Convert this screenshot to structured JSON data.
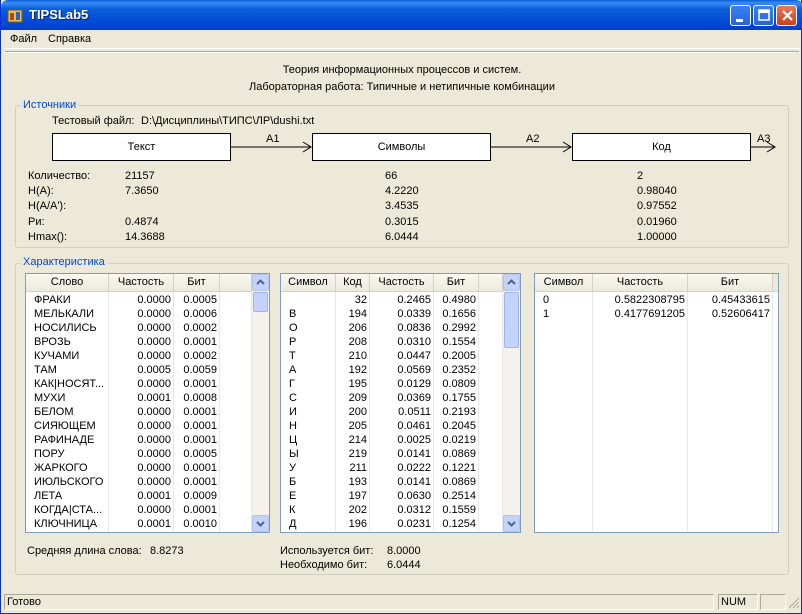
{
  "window": {
    "title": "TIPSLab5"
  },
  "menu": [
    "Файл",
    "Справка"
  ],
  "header": {
    "line1": "Теория информационных процессов и систем.",
    "line2": "Лабораторная работа: Типичные и нетипичные комбинации"
  },
  "sources": {
    "group_title": "Источники",
    "file_label": "Тестовый файл:",
    "file_path": "D:\\Дисциплины\\ТИПС\\ЛР\\dushi.txt",
    "boxes": [
      "Текст",
      "Символы",
      "Код"
    ],
    "arrows": [
      "A1",
      "A2",
      "A3"
    ],
    "row_labels": [
      "Количество:",
      "H(A):",
      "H(A/A'):",
      "Pи:",
      "Hmax():"
    ],
    "text_values": [
      "21157",
      "7.3650",
      "",
      "0.4874",
      "14.3688"
    ],
    "symbol_values": [
      "66",
      "4.2220",
      "3.4535",
      "0.3015",
      "6.0444"
    ],
    "code_values": [
      "2",
      "0.98040",
      "0.97552",
      "0.01960",
      "1.00000"
    ]
  },
  "characteristics": {
    "group_title": "Характеристика",
    "words": {
      "headers": [
        "Слово",
        "Частость",
        "Бит"
      ],
      "rows": [
        [
          "ФРАКИ",
          "0.0000",
          "0.0005"
        ],
        [
          "МЕЛЬКАЛИ",
          "0.0000",
          "0.0006"
        ],
        [
          "НОСИЛИСЬ",
          "0.0000",
          "0.0002"
        ],
        [
          "ВРОЗЬ",
          "0.0000",
          "0.0001"
        ],
        [
          "КУЧАМИ",
          "0.0000",
          "0.0002"
        ],
        [
          "ТАМ",
          "0.0005",
          "0.0059"
        ],
        [
          "КАК|НОСЯТ...",
          "0.0000",
          "0.0001"
        ],
        [
          "МУХИ",
          "0.0001",
          "0.0008"
        ],
        [
          "БЕЛОМ",
          "0.0000",
          "0.0001"
        ],
        [
          "СИЯЮЩЕМ",
          "0.0000",
          "0.0001"
        ],
        [
          "РАФИНАДЕ",
          "0.0000",
          "0.0001"
        ],
        [
          "ПОРУ",
          "0.0000",
          "0.0005"
        ],
        [
          "ЖАРКОГО",
          "0.0000",
          "0.0001"
        ],
        [
          "ИЮЛЬСКОГО",
          "0.0000",
          "0.0001"
        ],
        [
          "ЛЕТА",
          "0.0001",
          "0.0009"
        ],
        [
          "КОГДА|СТА...",
          "0.0000",
          "0.0001"
        ],
        [
          "КЛЮЧНИЦА",
          "0.0001",
          "0.0010"
        ]
      ]
    },
    "symbols": {
      "headers": [
        "Символ",
        "Код",
        "Частость",
        "Бит"
      ],
      "rows": [
        [
          "",
          "32",
          "0.2465",
          "0.4980"
        ],
        [
          "В",
          "194",
          "0.0339",
          "0.1656"
        ],
        [
          "О",
          "206",
          "0.0836",
          "0.2992"
        ],
        [
          "Р",
          "208",
          "0.0310",
          "0.1554"
        ],
        [
          "Т",
          "210",
          "0.0447",
          "0.2005"
        ],
        [
          "А",
          "192",
          "0.0569",
          "0.2352"
        ],
        [
          "Г",
          "195",
          "0.0129",
          "0.0809"
        ],
        [
          "С",
          "209",
          "0.0369",
          "0.1755"
        ],
        [
          "И",
          "200",
          "0.0511",
          "0.2193"
        ],
        [
          "Н",
          "205",
          "0.0461",
          "0.2045"
        ],
        [
          "Ц",
          "214",
          "0.0025",
          "0.0219"
        ],
        [
          "Ы",
          "219",
          "0.0141",
          "0.0869"
        ],
        [
          "У",
          "211",
          "0.0222",
          "0.1221"
        ],
        [
          "Б",
          "193",
          "0.0141",
          "0.0869"
        ],
        [
          "Е",
          "197",
          "0.0630",
          "0.2514"
        ],
        [
          "К",
          "202",
          "0.0312",
          "0.1559"
        ],
        [
          "Д",
          "196",
          "0.0231",
          "0.1254"
        ]
      ]
    },
    "codes": {
      "headers": [
        "Символ",
        "Частость",
        "Бит"
      ],
      "rows": [
        [
          "0",
          "0.5822308795",
          "0.45433615"
        ],
        [
          "1",
          "0.4177691205",
          "0.52606417"
        ]
      ]
    },
    "avg_word_label": "Средняя длина слова:",
    "avg_word_value": "8.8273",
    "bits_used_label": "Используется бит:",
    "bits_used_value": "8.0000",
    "bits_needed_label": "Необходимо бит:",
    "bits_needed_value": "6.0444"
  },
  "status": {
    "text": "Готово",
    "num": "NUM"
  }
}
